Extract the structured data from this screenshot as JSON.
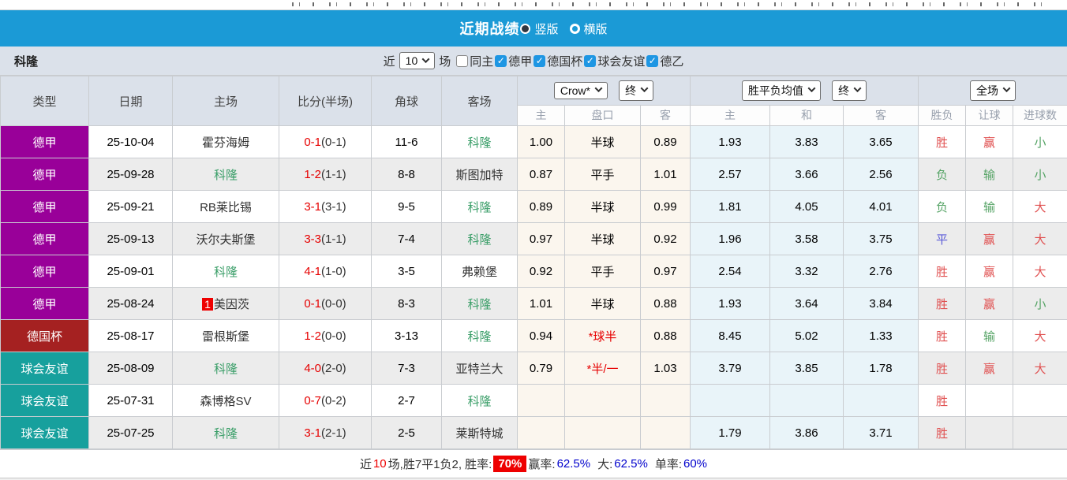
{
  "title_bar": {
    "title": "近期战绩",
    "radio_vertical": "竖版",
    "radio_horizontal": "横版"
  },
  "filter_bar": {
    "team": "科隆",
    "near_label": "近",
    "matches_value": "10",
    "matches_suffix": "场",
    "same_home_label": "同主",
    "league_filters": [
      {
        "label": "德甲",
        "checked": true
      },
      {
        "label": "德国杯",
        "checked": true
      },
      {
        "label": "球会友谊",
        "checked": true
      },
      {
        "label": "德乙",
        "checked": true
      }
    ]
  },
  "table": {
    "main_headers": [
      "类型",
      "日期",
      "主场",
      "比分(半场)",
      "角球",
      "客场"
    ],
    "selects": {
      "bookmaker": "Crow*",
      "bookmaker_state": "终",
      "average": "胜平负均值",
      "average_state": "终",
      "scope": "全场"
    },
    "sub_headers": [
      "主",
      "盘口",
      "客",
      "主",
      "和",
      "客",
      "胜负",
      "让球",
      "进球数"
    ],
    "league_colors": {
      "德甲": "#990099",
      "德国杯": "#a52121",
      "球会友谊": "#17a09d"
    },
    "rows": [
      {
        "league": "德甲",
        "date": "25-10-04",
        "home": "霍芬海姆",
        "home_focus": false,
        "home_rank": "",
        "score_ft": "0-1",
        "score_ht": "(0-1)",
        "corners": "11-6",
        "away": "科隆",
        "away_focus": true,
        "odds_home": "1.00",
        "handicap": "半球",
        "handicap_red": false,
        "odds_away": "0.89",
        "avg_home": "1.93",
        "avg_draw": "3.83",
        "avg_away": "3.65",
        "result_wdl": "胜",
        "result_wdl_color": "red",
        "result_handicap": "赢",
        "result_handicap_color": "red",
        "result_goals": "小",
        "result_goals_color": "green"
      },
      {
        "league": "德甲",
        "date": "25-09-28",
        "home": "科隆",
        "home_focus": true,
        "home_rank": "",
        "score_ft": "1-2",
        "score_ht": "(1-1)",
        "corners": "8-8",
        "away": "斯图加特",
        "away_focus": false,
        "odds_home": "0.87",
        "handicap": "平手",
        "handicap_red": false,
        "odds_away": "1.01",
        "avg_home": "2.57",
        "avg_draw": "3.66",
        "avg_away": "2.56",
        "result_wdl": "负",
        "result_wdl_color": "green",
        "result_handicap": "输",
        "result_handicap_color": "green",
        "result_goals": "小",
        "result_goals_color": "green"
      },
      {
        "league": "德甲",
        "date": "25-09-21",
        "home": "RB莱比锡",
        "home_focus": false,
        "home_rank": "",
        "score_ft": "3-1",
        "score_ht": "(3-1)",
        "corners": "9-5",
        "away": "科隆",
        "away_focus": true,
        "odds_home": "0.89",
        "handicap": "半球",
        "handicap_red": false,
        "odds_away": "0.99",
        "avg_home": "1.81",
        "avg_draw": "4.05",
        "avg_away": "4.01",
        "result_wdl": "负",
        "result_wdl_color": "green",
        "result_handicap": "输",
        "result_handicap_color": "green",
        "result_goals": "大",
        "result_goals_color": "red"
      },
      {
        "league": "德甲",
        "date": "25-09-13",
        "home": "沃尔夫斯堡",
        "home_focus": false,
        "home_rank": "",
        "score_ft": "3-3",
        "score_ht": "(1-1)",
        "corners": "7-4",
        "away": "科隆",
        "away_focus": true,
        "odds_home": "0.97",
        "handicap": "半球",
        "handicap_red": false,
        "odds_away": "0.92",
        "avg_home": "1.96",
        "avg_draw": "3.58",
        "avg_away": "3.75",
        "result_wdl": "平",
        "result_wdl_color": "blue",
        "result_handicap": "赢",
        "result_handicap_color": "red",
        "result_goals": "大",
        "result_goals_color": "red"
      },
      {
        "league": "德甲",
        "date": "25-09-01",
        "home": "科隆",
        "home_focus": true,
        "home_rank": "",
        "score_ft": "4-1",
        "score_ht": "(1-0)",
        "corners": "3-5",
        "away": "弗赖堡",
        "away_focus": false,
        "odds_home": "0.92",
        "handicap": "平手",
        "handicap_red": false,
        "odds_away": "0.97",
        "avg_home": "2.54",
        "avg_draw": "3.32",
        "avg_away": "2.76",
        "result_wdl": "胜",
        "result_wdl_color": "red",
        "result_handicap": "赢",
        "result_handicap_color": "red",
        "result_goals": "大",
        "result_goals_color": "red"
      },
      {
        "league": "德甲",
        "date": "25-08-24",
        "home": "美因茨",
        "home_focus": false,
        "home_rank": "1",
        "score_ft": "0-1",
        "score_ht": "(0-0)",
        "corners": "8-3",
        "away": "科隆",
        "away_focus": true,
        "odds_home": "1.01",
        "handicap": "半球",
        "handicap_red": false,
        "odds_away": "0.88",
        "avg_home": "1.93",
        "avg_draw": "3.64",
        "avg_away": "3.84",
        "result_wdl": "胜",
        "result_wdl_color": "red",
        "result_handicap": "赢",
        "result_handicap_color": "red",
        "result_goals": "小",
        "result_goals_color": "green"
      },
      {
        "league": "德国杯",
        "date": "25-08-17",
        "home": "雷根斯堡",
        "home_focus": false,
        "home_rank": "",
        "score_ft": "1-2",
        "score_ht": "(0-0)",
        "corners": "3-13",
        "away": "科隆",
        "away_focus": true,
        "odds_home": "0.94",
        "handicap": "*球半",
        "handicap_red": true,
        "odds_away": "0.88",
        "avg_home": "8.45",
        "avg_draw": "5.02",
        "avg_away": "1.33",
        "result_wdl": "胜",
        "result_wdl_color": "red",
        "result_handicap": "输",
        "result_handicap_color": "green",
        "result_goals": "大",
        "result_goals_color": "red"
      },
      {
        "league": "球会友谊",
        "date": "25-08-09",
        "home": "科隆",
        "home_focus": true,
        "home_rank": "",
        "score_ft": "4-0",
        "score_ht": "(2-0)",
        "corners": "7-3",
        "away": "亚特兰大",
        "away_focus": false,
        "odds_home": "0.79",
        "handicap": "*半/一",
        "handicap_red": true,
        "odds_away": "1.03",
        "avg_home": "3.79",
        "avg_draw": "3.85",
        "avg_away": "1.78",
        "result_wdl": "胜",
        "result_wdl_color": "red",
        "result_handicap": "赢",
        "result_handicap_color": "red",
        "result_goals": "大",
        "result_goals_color": "red"
      },
      {
        "league": "球会友谊",
        "date": "25-07-31",
        "home": "森博格SV",
        "home_focus": false,
        "home_rank": "",
        "score_ft": "0-7",
        "score_ht": "(0-2)",
        "corners": "2-7",
        "away": "科隆",
        "away_focus": true,
        "odds_home": "",
        "handicap": "",
        "handicap_red": false,
        "odds_away": "",
        "avg_home": "",
        "avg_draw": "",
        "avg_away": "",
        "result_wdl": "胜",
        "result_wdl_color": "red",
        "result_handicap": "",
        "result_handicap_color": "",
        "result_goals": "",
        "result_goals_color": ""
      },
      {
        "league": "球会友谊",
        "date": "25-07-25",
        "home": "科隆",
        "home_focus": true,
        "home_rank": "",
        "score_ft": "3-1",
        "score_ht": "(2-1)",
        "corners": "2-5",
        "away": "莱斯特城",
        "away_focus": false,
        "odds_home": "",
        "handicap": "",
        "handicap_red": false,
        "odds_away": "",
        "avg_home": "1.79",
        "avg_draw": "3.86",
        "avg_away": "3.71",
        "result_wdl": "胜",
        "result_wdl_color": "red",
        "result_handicap": "",
        "result_handicap_color": "",
        "result_goals": "",
        "result_goals_color": ""
      }
    ]
  },
  "footer": {
    "prefix": "近",
    "count": "10",
    "mid": "场,胜7平1负2, 胜率:",
    "win_rate": "70%",
    "sections": [
      {
        "label": "赢率:",
        "value": "62.5%"
      },
      {
        "label": "大:",
        "value": "62.5%"
      },
      {
        "label": "单率:",
        "value": "60%"
      }
    ]
  }
}
